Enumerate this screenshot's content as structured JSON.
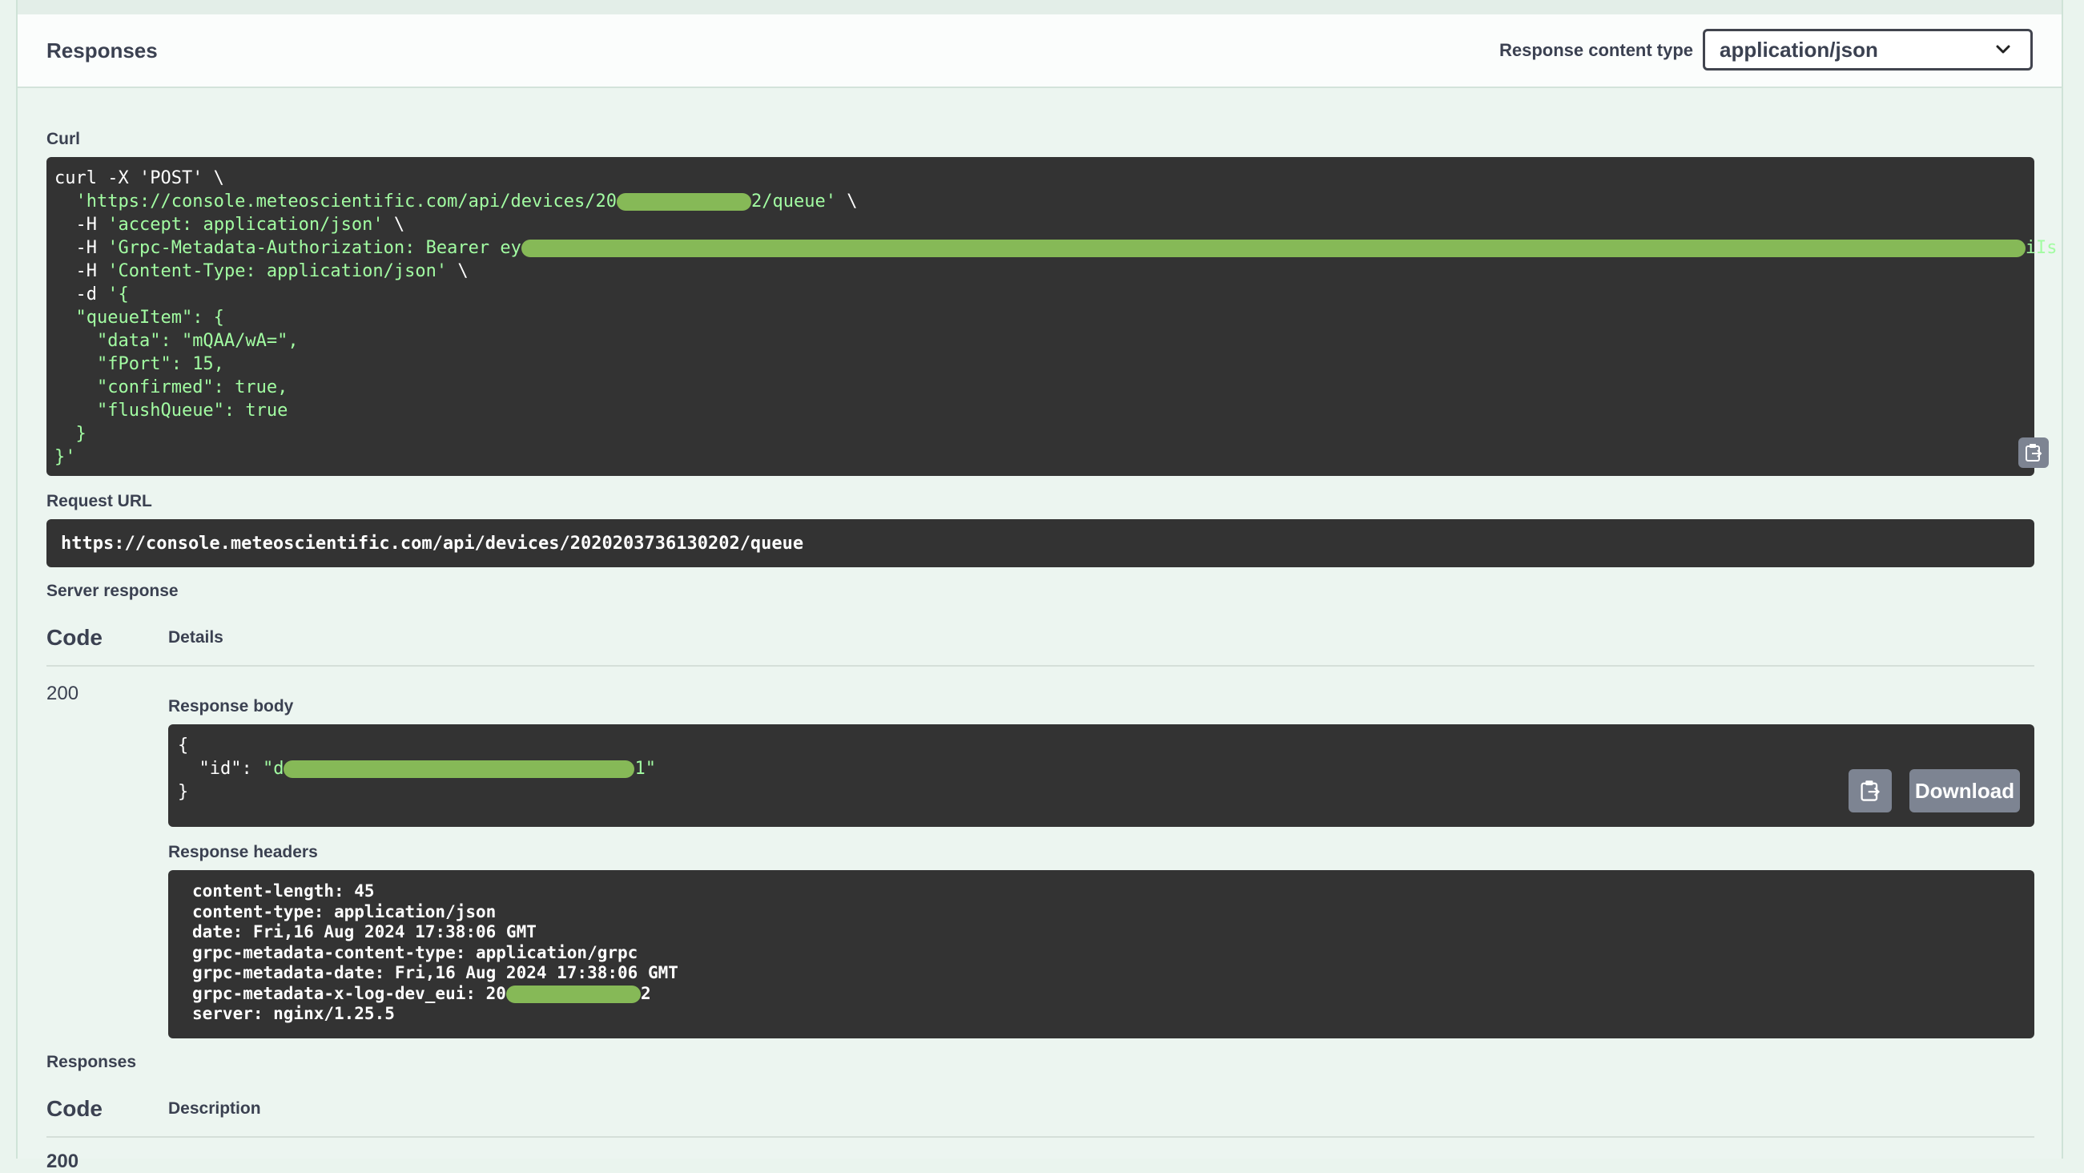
{
  "header": {
    "title": "Responses",
    "content_type_label": "Response content type",
    "content_type_value": "application/json"
  },
  "curl": {
    "label": "Curl",
    "line1": "curl -X 'POST' \\",
    "line2_pre": "'https://console.meteoscientific.com/api/devices/20",
    "line2_post": "2/queue'",
    "line2_tail": " \\",
    "line3_pre": "-H ",
    "line3_str": "'accept: application/json'",
    "line3_tail": " \\",
    "line4_pre": "-H ",
    "line4_str_pre": "'Grpc-Metadata-Authorization: Bearer ey",
    "line4_str_post": "iIs",
    "line5_pre": "-H ",
    "line5_str": "'Content-Type: application/json'",
    "line5_tail": " \\",
    "line6_pre": "-d ",
    "line6_str": "'{",
    "line7": "\"queueItem\": {",
    "line8": "\"data\": \"mQAA/wA=\",",
    "line9": "\"fPort\": 15,",
    "line10": "\"confirmed\": true,",
    "line11": "\"flushQueue\": true",
    "line12": "}",
    "line13": "}'"
  },
  "request_url": {
    "label": "Request URL",
    "value": "https://console.meteoscientific.com/api/devices/2020203736130202/queue"
  },
  "server_response": {
    "label": "Server response",
    "col_code": "Code",
    "col_details": "Details",
    "code": "200",
    "body_label": "Response body",
    "body_line1": "{",
    "body_line2_key": "\"id\": ",
    "body_line2_pre": "\"d",
    "body_line2_post": "1\"",
    "body_line3": "}",
    "download_label": "Download",
    "headers_label": "Response headers",
    "headers": [
      "content-length: 45",
      "content-type: application/json",
      "date: Fri,16 Aug 2024 17:38:06 GMT",
      "grpc-metadata-content-type: application/grpc",
      "grpc-metadata-date: Fri,16 Aug 2024 17:38:06 GMT"
    ],
    "header_eui_pre": "grpc-metadata-x-log-dev_eui: 20",
    "header_eui_post": "2",
    "header_server": "server: nginx/1.25.5"
  },
  "responses": {
    "label": "Responses",
    "col_code": "Code",
    "col_description": "Description",
    "first_code": "200"
  }
}
